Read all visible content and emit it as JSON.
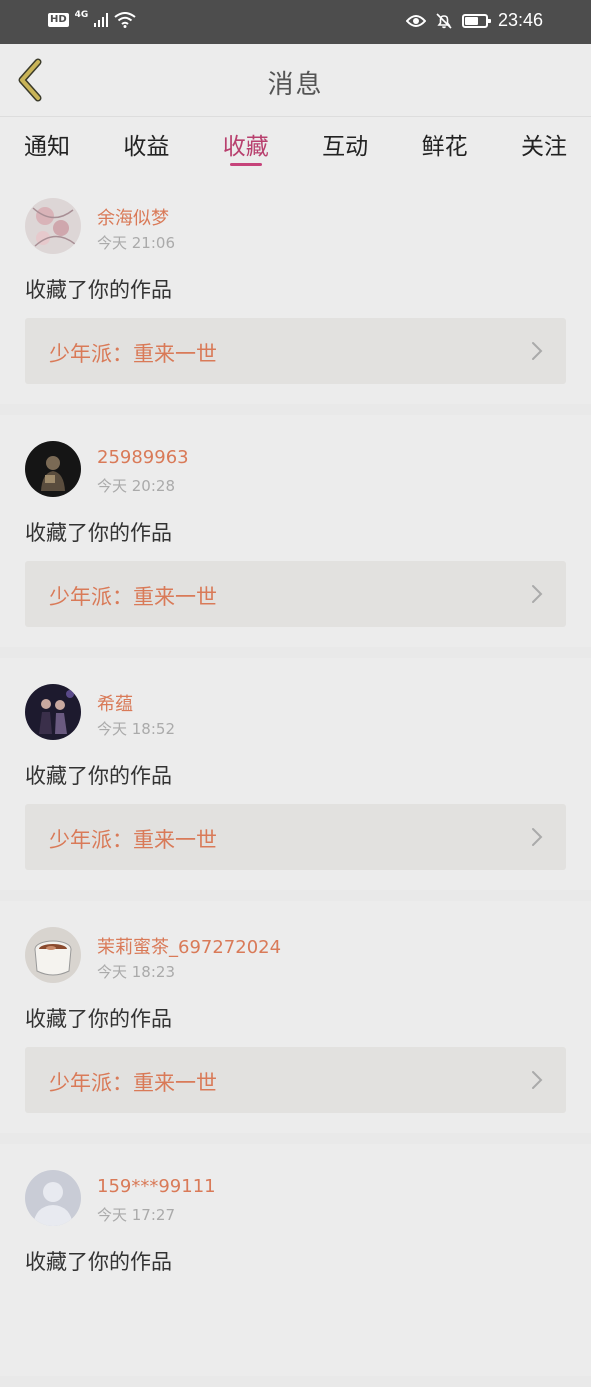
{
  "status_bar": {
    "hd": "HD",
    "network": "4G",
    "time": "23:46",
    "battery_level": 0.65,
    "icons": [
      "signal-icon",
      "wifi-icon",
      "eye-icon",
      "bell-off-icon",
      "battery-icon"
    ]
  },
  "header": {
    "title": "消息",
    "back_icon": "chevron-left-icon",
    "back_color": "#c9b458"
  },
  "tabs": [
    {
      "label": "通知"
    },
    {
      "label": "收益"
    },
    {
      "label": "收藏"
    },
    {
      "label": "互动"
    },
    {
      "label": "鲜花"
    },
    {
      "label": "关注"
    }
  ],
  "active_tab": "收藏",
  "colors": {
    "accent": "#c6437a",
    "username": "#d97a58",
    "status_bar": "#4d4d4d"
  },
  "messages": [
    {
      "username": "余海似梦",
      "time": "今天 21:06",
      "action": "收藏了你的作品",
      "work": "少年派：重来一世"
    },
    {
      "username": "25989963",
      "time": "今天 20:28",
      "action": "收藏了你的作品",
      "work": "少年派：重来一世"
    },
    {
      "username": "希蕴",
      "time": "今天 18:52",
      "action": "收藏了你的作品",
      "work": "少年派：重来一世"
    },
    {
      "username": "茉莉蜜茶_697272024",
      "time": "今天 18:23",
      "action": "收藏了你的作品",
      "work": "少年派：重来一世"
    },
    {
      "username": "159***99111",
      "time": "今天 17:27",
      "action": "收藏了你的作品",
      "work": ""
    }
  ]
}
